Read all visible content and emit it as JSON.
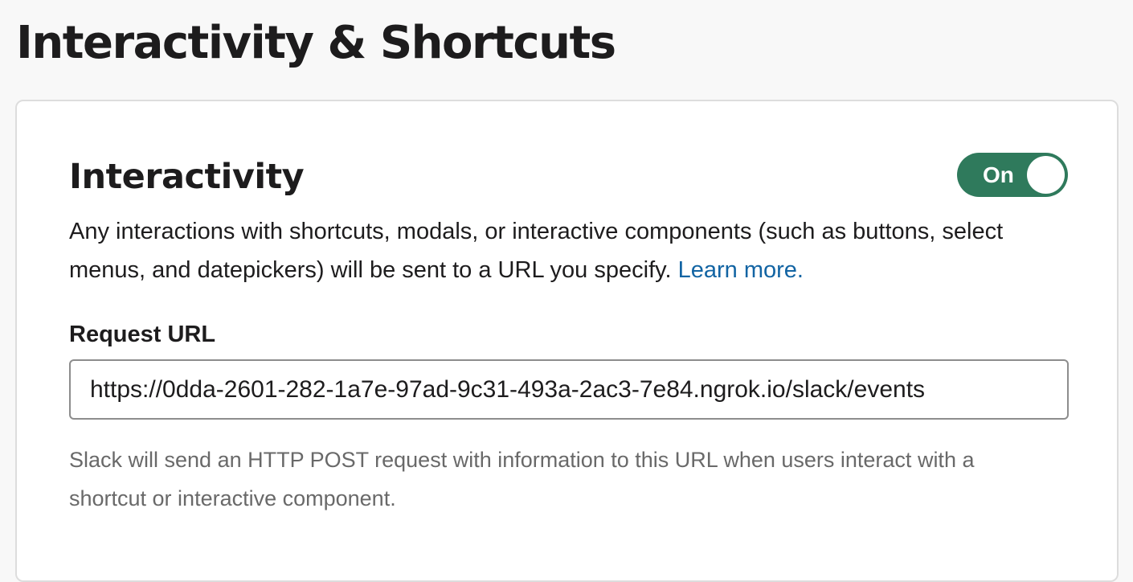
{
  "page": {
    "title": "Interactivity & Shortcuts"
  },
  "interactivity": {
    "title": "Interactivity",
    "toggle": {
      "state": "on",
      "label": "On",
      "color": "#2f7a5c"
    },
    "description": "Any interactions with shortcuts, modals, or interactive components (such as buttons, select menus, and datepickers) will be sent to a URL you specify.",
    "learn_more_label": "Learn more.",
    "link_color": "#1264a3",
    "request_url": {
      "label": "Request URL",
      "value": "https://0dda-2601-282-1a7e-97ad-9c31-493a-2ac3-7e84.ngrok.io/slack/events"
    },
    "help_text": "Slack will send an HTTP POST request with information to this URL when users interact with a shortcut or interactive component."
  }
}
